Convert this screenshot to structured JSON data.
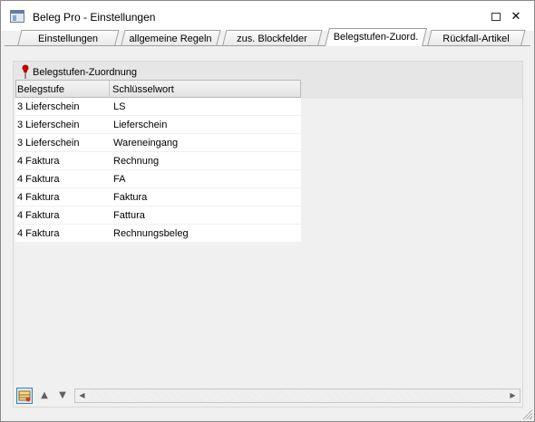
{
  "window": {
    "title": "Beleg Pro - Einstellungen",
    "controls": {
      "minimize": "—",
      "maximize": "",
      "close": "✕"
    }
  },
  "tabs": [
    {
      "label": "Einstellungen",
      "active": false
    },
    {
      "label": "allgemeine Regeln",
      "active": false
    },
    {
      "label": "zus. Blockfelder",
      "active": false
    },
    {
      "label": "Belegstufen-Zuord.",
      "active": true
    },
    {
      "label": "Rückfall-Artikel",
      "active": false
    }
  ],
  "section": {
    "title": "Belegstufen-Zuordnung",
    "icon": "pin-icon"
  },
  "grid": {
    "columns": [
      "Belegstufe",
      "Schlüsselwort"
    ],
    "rows": [
      [
        "3 Lieferschein",
        "LS"
      ],
      [
        "3 Lieferschein",
        "Lieferschein"
      ],
      [
        "3 Lieferschein",
        "Wareneingang"
      ],
      [
        "4 Faktura",
        "Rechnung"
      ],
      [
        "4 Faktura",
        "FA"
      ],
      [
        "4 Faktura",
        "Faktura"
      ],
      [
        "4 Faktura",
        "Fattura"
      ],
      [
        "4 Faktura",
        "Rechnungsbeleg"
      ]
    ]
  },
  "toolbar": {
    "buttons": [
      {
        "icon": "table-edit-icon",
        "glyph": "▤"
      },
      {
        "icon": "arrow-up-icon",
        "glyph": "▲"
      },
      {
        "icon": "arrow-down-icon",
        "glyph": "▼"
      }
    ],
    "scroll_left": "◀",
    "scroll_right": "▶"
  },
  "colors": {
    "accent": "#3c7fb1",
    "pin": "#c00000"
  }
}
